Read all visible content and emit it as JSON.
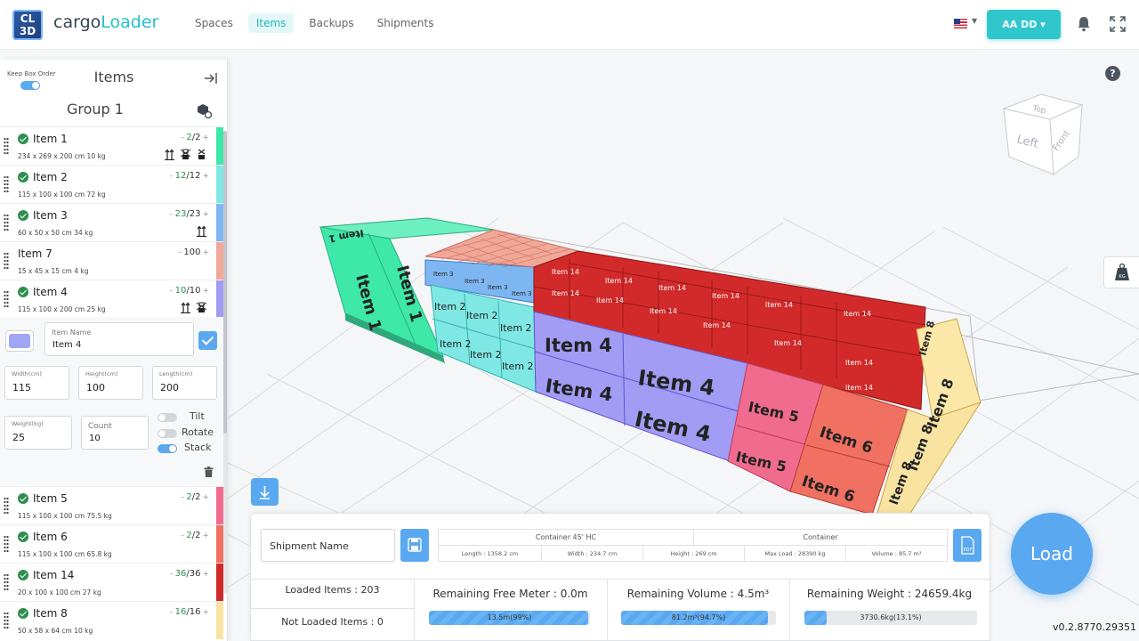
{
  "brand": {
    "logo_text": "CL\n3D",
    "name_a": "cargo",
    "name_b": "Loader"
  },
  "nav": [
    {
      "label": "Spaces",
      "active": false
    },
    {
      "label": "Items",
      "active": true
    },
    {
      "label": "Backups",
      "active": false
    },
    {
      "label": "Shipments",
      "active": false
    }
  ],
  "user": {
    "label": "AA DD ▾"
  },
  "icons": {
    "bell": "bell-icon",
    "fullscreen": "fullscreen-icon",
    "help": "help-icon",
    "weight": "kg-icon"
  },
  "panel": {
    "keep_box_order_label": "Keep Box Order",
    "keep_box_order_on": true,
    "title": "Items",
    "group_title": "Group 1",
    "items": [
      {
        "name": "Item 1",
        "dims": "234 x 269 x 200 cm 10 kg",
        "loaded": "2",
        "total": "/2",
        "color": "#3ee8a8",
        "checked": true
      },
      {
        "name": "Item 2",
        "dims": "115 x 100 x 100 cm 72 kg",
        "loaded": "12",
        "total": "/12",
        "color": "#7fe8e4",
        "checked": true
      },
      {
        "name": "Item 3",
        "dims": "60 x 50 x 50 cm 34 kg",
        "loaded": "23",
        "total": "/23",
        "color": "#7eb6f2",
        "checked": true
      },
      {
        "name": "Item 7",
        "dims": "15 x 45 x 15 cm 4 kg",
        "loaded": "",
        "total": "100",
        "color": "#f2a898",
        "checked": false
      },
      {
        "name": "Item 4",
        "dims": "115 x 100 x 200 cm 25 kg",
        "loaded": "10",
        "total": "/10",
        "color": "#a29cf5",
        "checked": true
      }
    ],
    "items_after": [
      {
        "name": "Item 5",
        "dims": "115 x 100 x 100 cm 75.5 kg",
        "loaded": "2",
        "total": "/2",
        "color": "#f06b8e",
        "checked": true
      },
      {
        "name": "Item 6",
        "dims": "115 x 100 x 100 cm 65.8 kg",
        "loaded": "2",
        "total": "/2",
        "color": "#f07062",
        "checked": true
      },
      {
        "name": "Item 14",
        "dims": "20 x 100 x 100 cm 27 kg",
        "loaded": "36",
        "total": "/36",
        "color": "#d22a2a",
        "checked": true
      },
      {
        "name": "Item 8",
        "dims": "50 x 58 x 64 cm 10 kg",
        "loaded": "16",
        "total": "/16",
        "color": "#f9e3a1",
        "checked": true
      }
    ],
    "edit": {
      "name_label": "Item Name",
      "name_value": "Item 4",
      "width_label": "Width(cm)",
      "width_value": "115",
      "height_label": "Height(cm)",
      "height_value": "100",
      "length_label": "Length(cm)",
      "length_value": "200",
      "weight_label": "Weight(kg)",
      "weight_value": "25",
      "count_label": "Count",
      "count_value": "10",
      "tilt_label": "Tilt",
      "tilt_on": false,
      "rotate_label": "Rotate",
      "rotate_on": false,
      "stack_label": "Stack",
      "stack_on": true,
      "color": "#9fa6f5"
    }
  },
  "viewcube": {
    "top": "Top",
    "left": "Left",
    "front": "Front"
  },
  "info": {
    "shipment_placeholder": "Shipment Name",
    "container_header": "Container 45' HC",
    "container_type": "Container",
    "length": "Length : 1358.2 cm",
    "width": "Width : 234.7 cm",
    "height": "Height : 269 cm",
    "max_load": "Max Load : 28390 kg",
    "volume": "Volume : 85.7 m³",
    "loaded_items": "Loaded Items : 203",
    "not_loaded_items": "Not Loaded Items : 0",
    "free_meter_title": "Remaining Free Meter : 0.0m",
    "free_meter_bar": "13.5m(99%)",
    "free_meter_pct": 99,
    "volume_title": "Remaining Volume : 4.5m³",
    "volume_bar": "81.2m³(94.7%)",
    "volume_pct": 94.7,
    "weight_title": "Remaining Weight : 24659.4kg",
    "weight_bar": "3730.6kg(13.1%)",
    "weight_pct": 13.1
  },
  "load_label": "Load",
  "version": "v0.2.8770.29351"
}
